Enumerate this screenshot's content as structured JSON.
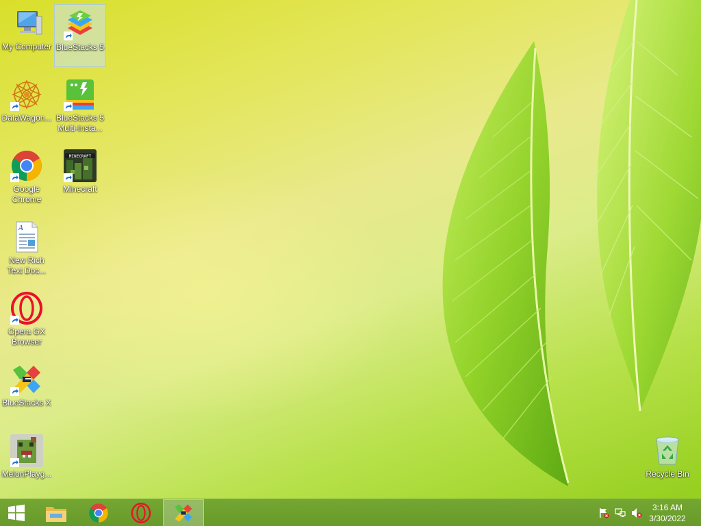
{
  "desktop": {
    "icons": [
      {
        "label": "My Computer",
        "icon": "computer-icon"
      },
      {
        "label": "BlueStacks 5",
        "icon": "bluestacks5-icon",
        "selected": true
      },
      {
        "label": "DataWagon...",
        "icon": "datawagon-icon"
      },
      {
        "label": "BlueStacks 5 Multi-Insta...",
        "icon": "bluestacks-multi-icon"
      },
      {
        "label": "Google Chrome",
        "icon": "chrome-icon"
      },
      {
        "label": "Minecraft",
        "icon": "minecraft-icon"
      },
      {
        "label": "New Rich Text Doc...",
        "icon": "document-icon"
      },
      {
        "label": "Opera GX Browser",
        "icon": "opera-gx-icon"
      },
      {
        "label": "BlueStacks X",
        "icon": "bluestacks-x-icon"
      },
      {
        "label": "MelonPlayg...",
        "icon": "melon-playground-icon"
      },
      {
        "label": "Recycle Bin",
        "icon": "recycle-bin-icon"
      }
    ]
  },
  "taskbar": {
    "start": "windows-logo-icon",
    "pinned": [
      "file-explorer-icon",
      "chrome-icon",
      "opera-icon",
      "bluestacks-x-icon"
    ],
    "active_app": "BlueStacks X",
    "tray": [
      "action-center-flag-icon",
      "network-icon",
      "volume-muted-icon"
    ],
    "clock": {
      "time": "3:16 AM",
      "date": "3/30/2022"
    }
  },
  "colors": {
    "taskbar": "#6c9f2e",
    "selection": "#c8e1eb",
    "wallpaper_top": "#d9df2a",
    "wallpaper_bottom": "#95cf1e"
  }
}
